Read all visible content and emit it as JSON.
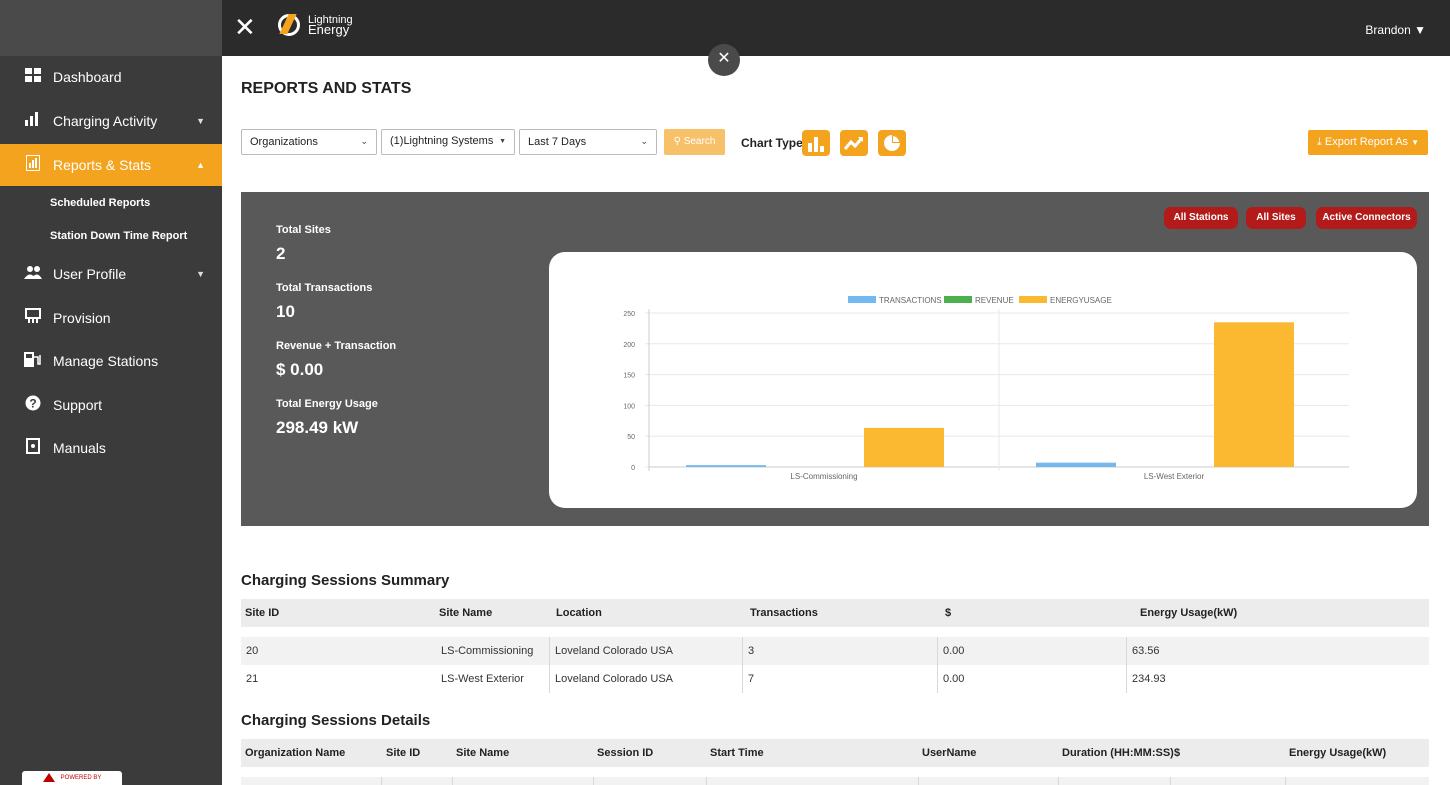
{
  "sidebar": {
    "items": [
      {
        "label": "Dashboard",
        "icon": "dashboard-grid-icon"
      },
      {
        "label": "Charging Activity",
        "icon": "bar-chart-icon"
      },
      {
        "label": "Reports & Stats",
        "icon": "report-icon"
      },
      {
        "label": "User Profile",
        "icon": "users-icon"
      },
      {
        "label": "Provision",
        "icon": "provision-icon"
      },
      {
        "label": "Manage Stations",
        "icon": "station-icon"
      },
      {
        "label": "Support",
        "icon": "question-icon"
      },
      {
        "label": "Manuals",
        "icon": "manual-icon"
      }
    ],
    "subitems": [
      "Scheduled Reports",
      "Station Down Time Report"
    ],
    "powered_by": "POWERED BY"
  },
  "topbar": {
    "logo_line1": "Lightning",
    "logo_line2": "Energy",
    "user": "Brandon ▼"
  },
  "page": {
    "title": "REPORTS AND STATS"
  },
  "filters": {
    "organization": "Organizations",
    "system": "(1)Lightning Systems",
    "range": "Last 7 Days",
    "search": "Search",
    "chart_type_label": "Chart Type",
    "export": "Export Report As"
  },
  "stats": {
    "total_sites_label": "Total Sites",
    "total_sites": "2",
    "total_transactions_label": "Total Transactions",
    "total_transactions": "10",
    "revenue_label": "Revenue + Transaction",
    "revenue": "$ 0.00",
    "energy_label": "Total Energy Usage",
    "energy": "298.49 kW"
  },
  "panel_buttons": [
    "All Stations",
    "All Sites",
    "Active Connectors"
  ],
  "colors": {
    "accent": "#f4a31f",
    "transactions": "#73b9f0",
    "revenue": "#4caf50",
    "energy": "#fbb931",
    "pill": "#b31b1b"
  },
  "chart_data": {
    "type": "bar",
    "categories": [
      "LS-Commissioning",
      "LS-West Exterior"
    ],
    "series": [
      {
        "name": "TRANSACTIONS",
        "values": [
          3,
          7
        ]
      },
      {
        "name": "REVENUE",
        "values": [
          0,
          0
        ]
      },
      {
        "name": "ENERGYUSAGE",
        "values": [
          63.56,
          234.93
        ]
      }
    ],
    "ylim": [
      0,
      250
    ],
    "yticks": [
      "0",
      "50",
      "100",
      "150",
      "200",
      "250"
    ],
    "legend": "top"
  },
  "summary": {
    "title": "Charging Sessions Summary",
    "headers": [
      "Site ID",
      "Site Name",
      "Location",
      "Transactions",
      "$",
      "Energy Usage(kW)"
    ],
    "rows": [
      [
        "20",
        "LS-Commissioning",
        "Loveland Colorado USA",
        "3",
        "0.00",
        "63.56"
      ],
      [
        "21",
        "LS-West Exterior",
        "Loveland Colorado USA",
        "7",
        "0.00",
        "234.93"
      ]
    ]
  },
  "details": {
    "title": "Charging Sessions Details",
    "headers": [
      "Organization Name",
      "Site ID",
      "Site Name",
      "Session ID",
      "Start Time",
      "UserName",
      "Duration (HH:MM:SS)",
      "$",
      "Energy Usage(kW)"
    ]
  }
}
